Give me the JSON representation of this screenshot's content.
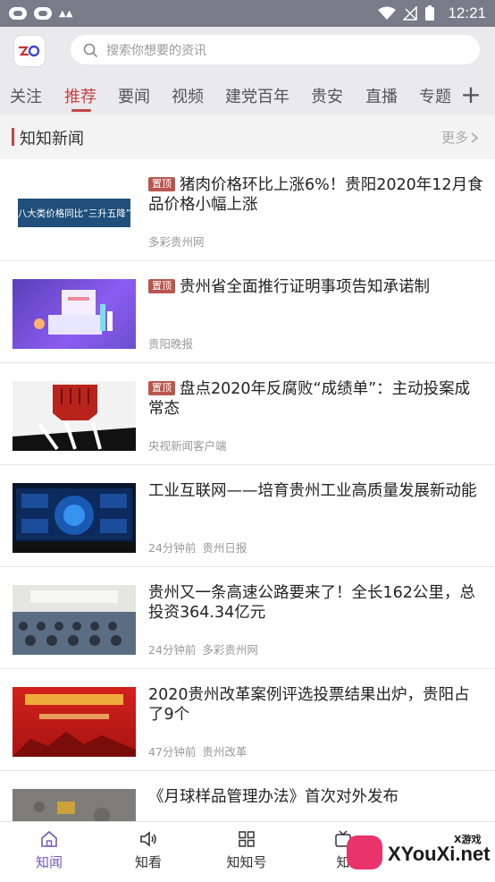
{
  "status_bar": {
    "time": "12:21"
  },
  "search": {
    "placeholder": "搜索你想要的资讯"
  },
  "tabs": [
    "关注",
    "推荐",
    "要闻",
    "视频",
    "建党百年",
    "贵安",
    "直播",
    "专题"
  ],
  "active_tab": "推荐",
  "section": {
    "title": "知知新闻",
    "more_label": "更多"
  },
  "news": [
    {
      "pinned": true,
      "pin_label": "置顶",
      "title": "猪肉价格环比上涨6%！贵阳2020年12月食品价格小幅上涨",
      "time": "",
      "source": "多彩贵州网",
      "thumb_text": "八大类价格同比“三升五降”"
    },
    {
      "pinned": true,
      "pin_label": "置顶",
      "title": "贵州省全面推行证明事项告知承诺制",
      "time": "",
      "source": "贵阳晚报"
    },
    {
      "pinned": true,
      "pin_label": "置顶",
      "title": "盘点2020年反腐败“成绩单”：主动投案成常态",
      "time": "",
      "source": "央视新闻客户端"
    },
    {
      "pinned": false,
      "title": "工业互联网——培育贵州工业高质量发展新动能",
      "time": "24分钟前",
      "source": "贵州日报"
    },
    {
      "pinned": false,
      "title": "贵州又一条高速公路要来了！全长162公里，总投资364.34亿元",
      "time": "24分钟前",
      "source": "多彩贵州网"
    },
    {
      "pinned": false,
      "title": "2020贵州改革案例评选投票结果出炉，贵阳占了9个",
      "time": "47分钟前",
      "source": "贵州改革"
    },
    {
      "pinned": false,
      "title": "《月球样品管理办法》首次对外发布",
      "time": "",
      "source": ""
    }
  ],
  "bottom_nav": [
    {
      "label": "知闻",
      "icon": "home-icon",
      "active": true
    },
    {
      "label": "知看",
      "icon": "speaker-icon",
      "active": false
    },
    {
      "label": "知知号",
      "icon": "grid-icon",
      "active": false
    },
    {
      "label": "知",
      "icon": "tv-icon",
      "active": false
    }
  ],
  "watermark": {
    "text": "XYouXi.net",
    "small": "X游戏"
  },
  "colors": {
    "accent": "#c24646",
    "nav_active": "#6a5bbf",
    "status_bar": "#7a7a88"
  }
}
